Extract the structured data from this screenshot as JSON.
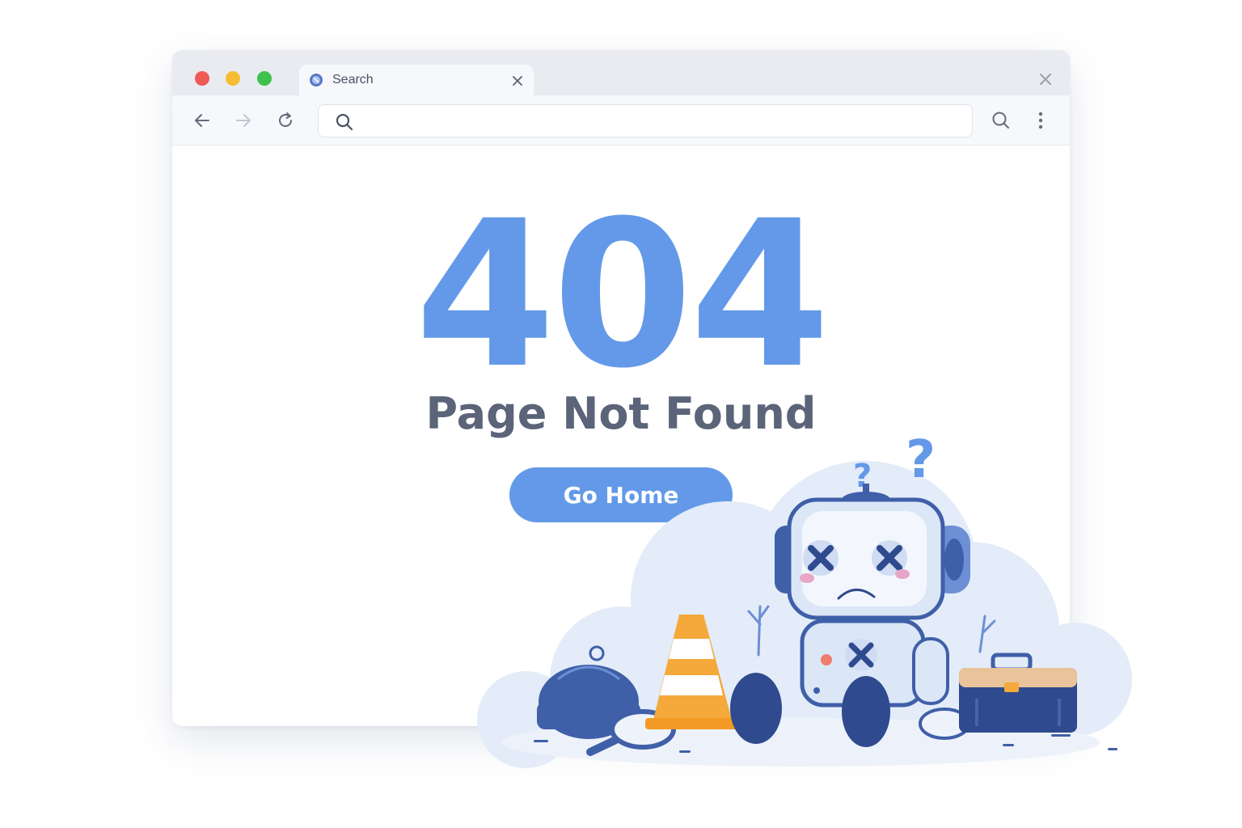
{
  "browser": {
    "tab": {
      "title": "Search",
      "favicon": "globe-icon",
      "close_icon": "close-icon"
    },
    "window_close_icon": "close-icon",
    "toolbar": {
      "back_icon": "arrow-left-icon",
      "forward_icon": "arrow-right-icon",
      "reload_icon": "reload-icon",
      "address": {
        "icon": "search-icon",
        "value": "",
        "placeholder": ""
      },
      "search_icon": "search-icon",
      "menu_icon": "more-vertical-icon"
    }
  },
  "page": {
    "error_code": "404",
    "title": "Page Not Found",
    "button_label": "Go Home"
  },
  "illustration": {
    "subject": "robot-icon",
    "items": [
      "question-mark-icon",
      "traffic-cone-icon",
      "magnifier-icon",
      "bag-icon",
      "toolbox-icon"
    ]
  },
  "colors": {
    "accent": "#6399e8",
    "title_text": "#5b6478",
    "traffic_red": "#ef5a55",
    "traffic_yellow": "#f7bd32",
    "traffic_green": "#3fc14d",
    "robot_blue": "#3f5fa8",
    "cone_orange": "#f4a93a"
  }
}
